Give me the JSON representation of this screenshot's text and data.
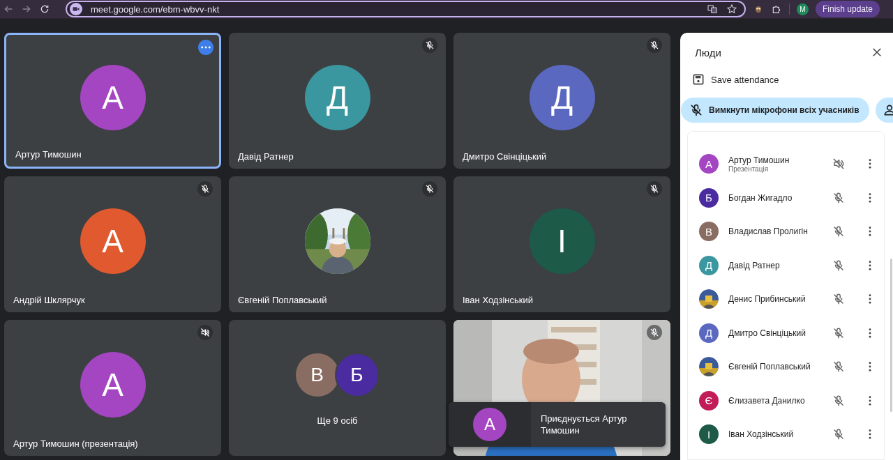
{
  "browser": {
    "url": "meet.google.com/ebm-wbvv-nkt",
    "profile_initial": "M",
    "update_button": "Finish update"
  },
  "tiles": [
    {
      "kind": "avatar",
      "name": "Артур Тимошин",
      "initial": "А",
      "color": "#a445c2",
      "selected": true,
      "mic_muted": false,
      "sound_muted": false
    },
    {
      "kind": "avatar",
      "name": "Давід Ратнер",
      "initial": "Д",
      "color": "#3b979f",
      "selected": false,
      "mic_muted": true,
      "sound_muted": false
    },
    {
      "kind": "avatar",
      "name": "Дмитро Свінціцький",
      "initial": "Д",
      "color": "#5b68bf",
      "selected": false,
      "mic_muted": true,
      "sound_muted": false
    },
    {
      "kind": "avatar",
      "name": "Андрій Шклярчук",
      "initial": "А",
      "color": "#e0592f",
      "selected": false,
      "mic_muted": true,
      "sound_muted": false
    },
    {
      "name": "Євгеній Поплавський",
      "selected": false,
      "mic_muted": true,
      "sound_muted": false
    },
    {
      "kind": "avatar",
      "name": "Іван Ходзінський",
      "initial": "І",
      "color": "#1d5a47",
      "selected": false,
      "mic_muted": true,
      "sound_muted": false
    },
    {
      "kind": "avatar",
      "name": "Артур Тимошин (презентація)",
      "initial": "А",
      "color": "#a445c2",
      "selected": false,
      "mic_muted": false,
      "sound_muted": true
    },
    {
      "kind": "group",
      "name": "Ще 9 осіб",
      "selected": false,
      "mic_muted": false,
      "sound_muted": false,
      "avatars": [
        {
          "initial": "В",
          "color": "#8a6d62"
        },
        {
          "initial": "Б",
          "color": "#4a2ba0"
        }
      ]
    },
    {
      "kind": "video",
      "selected": false,
      "mic_muted": true,
      "sound_muted": false
    }
  ],
  "toast": {
    "initial": "А",
    "color": "#a445c2",
    "text": "Приєднується Артур Тимошин"
  },
  "panel": {
    "title": "Люди",
    "save": "Save attendance",
    "mute_all": "Вимкнути мікрофони всіх учасників",
    "participants": [
      {
        "name": "Артур Тимошин",
        "subtitle": "Презентація",
        "kind": "letter",
        "initial": "А",
        "color": "#a445c2",
        "mic_muted": false,
        "sound_muted": true
      },
      {
        "name": "Богдан Жигадло",
        "kind": "letter",
        "initial": "Б",
        "color": "#4a2ba0",
        "mic_muted": true,
        "sound_muted": false
      },
      {
        "name": "Владислав Пролигін",
        "kind": "letter",
        "initial": "В",
        "color": "#8a6d62",
        "mic_muted": true,
        "sound_muted": false
      },
      {
        "name": "Давід Ратнер",
        "kind": "letter",
        "initial": "Д",
        "color": "#3b979f",
        "mic_muted": true,
        "sound_muted": false
      },
      {
        "name": "Денис Прибинський",
        "kind": "picture",
        "mic_muted": true,
        "sound_muted": false
      },
      {
        "name": "Дмитро Свінціцький",
        "kind": "letter",
        "initial": "Д",
        "color": "#5b68bf",
        "mic_muted": true,
        "sound_muted": false
      },
      {
        "name": "Євгеній Поплавський",
        "kind": "picture",
        "mic_muted": true,
        "sound_muted": false
      },
      {
        "name": "Єлизавета Данилко",
        "kind": "letter",
        "initial": "Є",
        "color": "#c21c58",
        "mic_muted": true,
        "sound_muted": false
      },
      {
        "name": "Іван Ходзінський",
        "kind": "letter",
        "initial": "І",
        "color": "#1d5a47",
        "mic_muted": true,
        "sound_muted": false
      }
    ]
  }
}
